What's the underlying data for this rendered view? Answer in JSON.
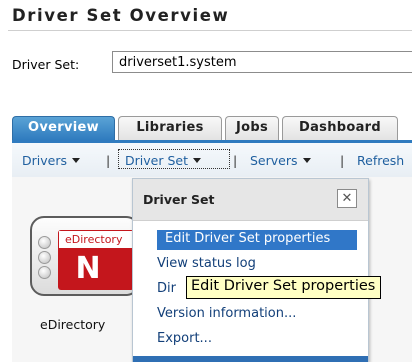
{
  "page": {
    "title": "Driver Set Overview"
  },
  "driver_set": {
    "label": "Driver Set:",
    "value": "driverset1.system"
  },
  "tabs": [
    {
      "label": "Overview",
      "active": true
    },
    {
      "label": "Libraries",
      "active": false
    },
    {
      "label": "Jobs",
      "active": false
    },
    {
      "label": "Dashboard",
      "active": false
    }
  ],
  "menubar": {
    "items": [
      {
        "label": "Drivers"
      },
      {
        "label": "Driver Set"
      },
      {
        "label": "Servers"
      },
      {
        "label": "Refresh"
      }
    ],
    "separator": "|"
  },
  "dropdown": {
    "title": "Driver Set",
    "close_icon": "close-icon",
    "items": [
      {
        "label": "Edit Driver Set properties",
        "selected": true
      },
      {
        "label": "View status log",
        "selected": false
      },
      {
        "label": "Dir",
        "selected": false
      },
      {
        "label": "Version information...",
        "selected": false
      },
      {
        "label": "Export...",
        "selected": false
      }
    ]
  },
  "tooltip": {
    "text": "Edit Driver Set properties"
  },
  "tile": {
    "name": "eDirectory",
    "logo_text": "eDirectory",
    "logo_letter": "N",
    "icon": "edirectory-icon"
  },
  "colors": {
    "accent": "#2f7bbf",
    "menu_link": "#1f5f9f",
    "selected_bg": "#3077c8",
    "logo_red": "#c4161c",
    "tooltip_bg": "#ffffc4"
  }
}
